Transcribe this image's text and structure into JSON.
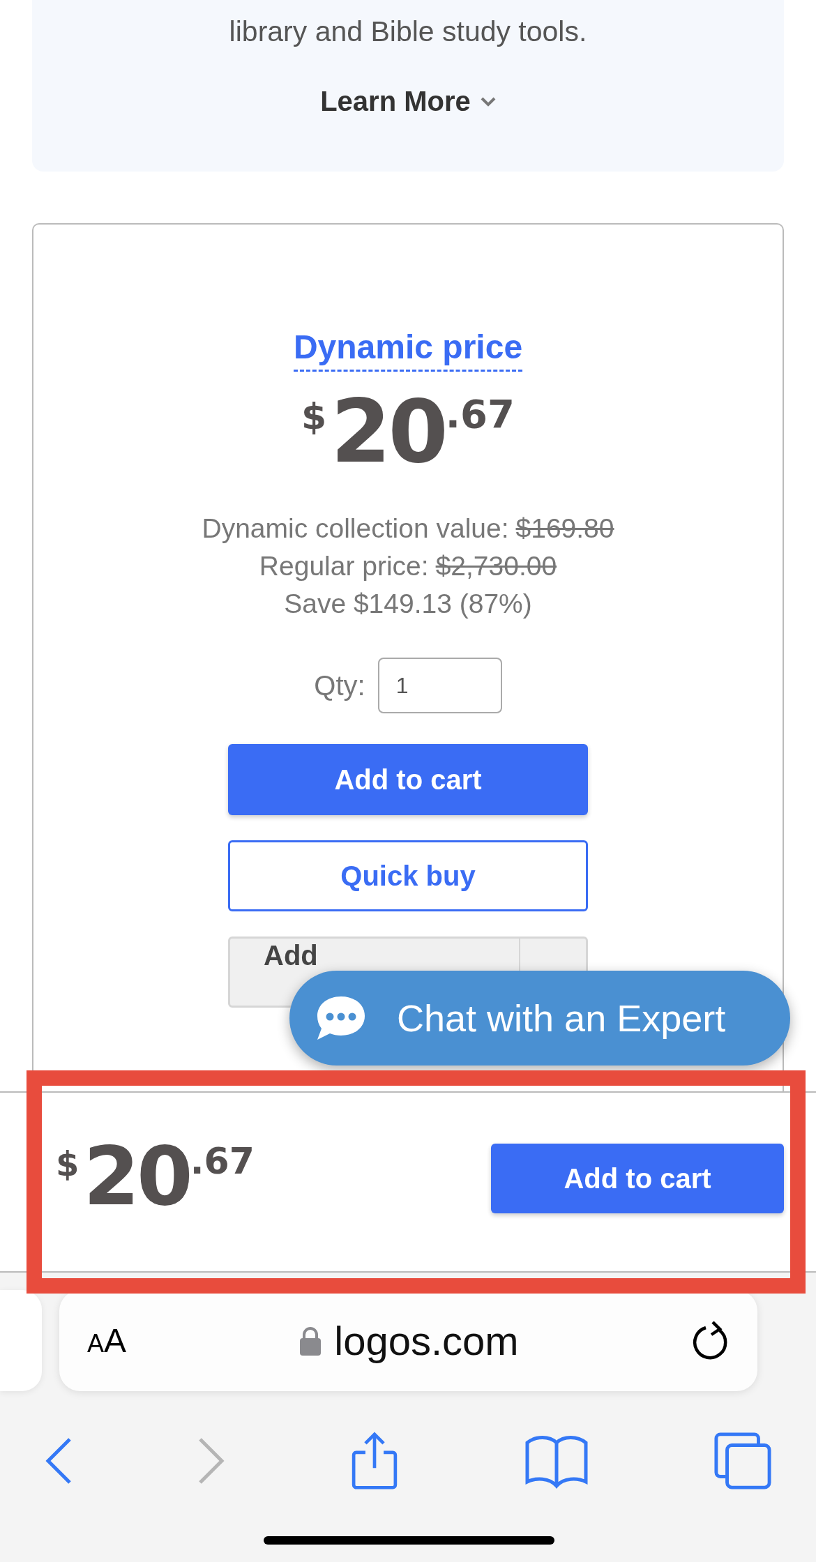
{
  "info_panel": {
    "text": "library and Bible study tools.",
    "learn_more": "Learn More"
  },
  "product": {
    "heading": "Dynamic price",
    "price": {
      "currency": "$",
      "whole": "20",
      "cents": ".67"
    },
    "details": [
      {
        "label": "Dynamic collection value:",
        "amount": "$169.80",
        "struck": true
      },
      {
        "label": "Regular price:",
        "amount": "$2,730.00",
        "struck": true
      },
      {
        "label": "Save $149.13 (87%)"
      }
    ],
    "qty": {
      "label": "Qty:",
      "value": "1"
    },
    "buttons": [
      {
        "kind": "primary",
        "label": "Add to cart"
      },
      {
        "kind": "outline",
        "label": "Quick buy"
      },
      {
        "kind": "split",
        "label": "Add"
      }
    ]
  },
  "chat": {
    "label": "Chat with an Expert"
  },
  "sticky_bar": {
    "price": {
      "currency": "$",
      "whole": "20",
      "cents": ".67"
    },
    "button": "Add to cart",
    "highlighted": true
  },
  "browser": {
    "text_size": "AA",
    "url": "logos.com",
    "forward_disabled": true
  }
}
